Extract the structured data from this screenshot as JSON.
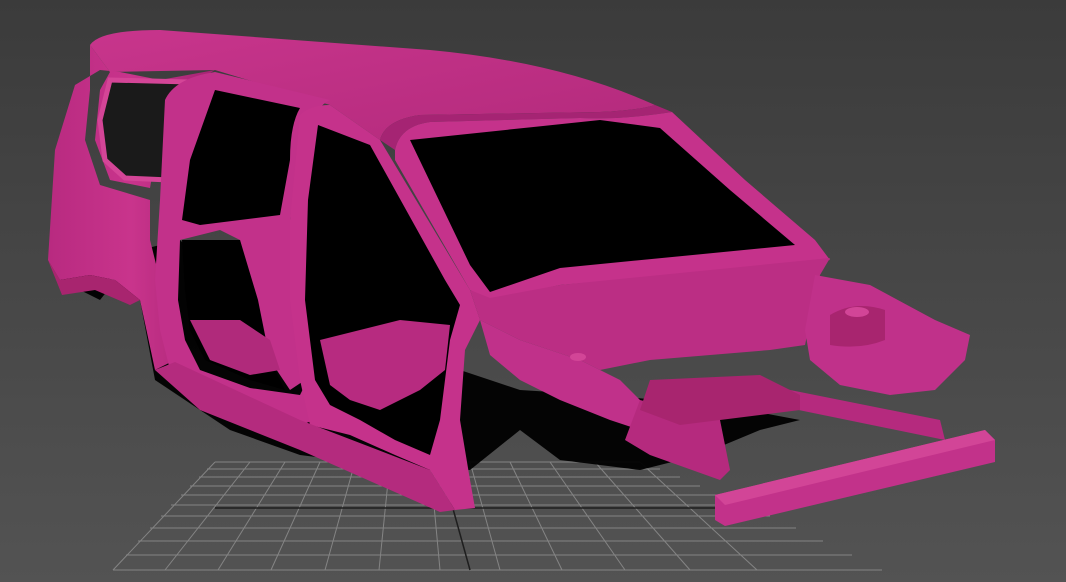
{
  "viewport": {
    "background_top": "#3a3a3a",
    "background_bottom": "#505050",
    "grid_color": "#8a8a8a",
    "grid_axis_color": "#1e1e1e",
    "model_color": "#c22f86",
    "model_shade": "#9e2170",
    "model_highlight": "#d8489c",
    "model_dark": "#6d1650",
    "shadow_color": "#000000"
  }
}
